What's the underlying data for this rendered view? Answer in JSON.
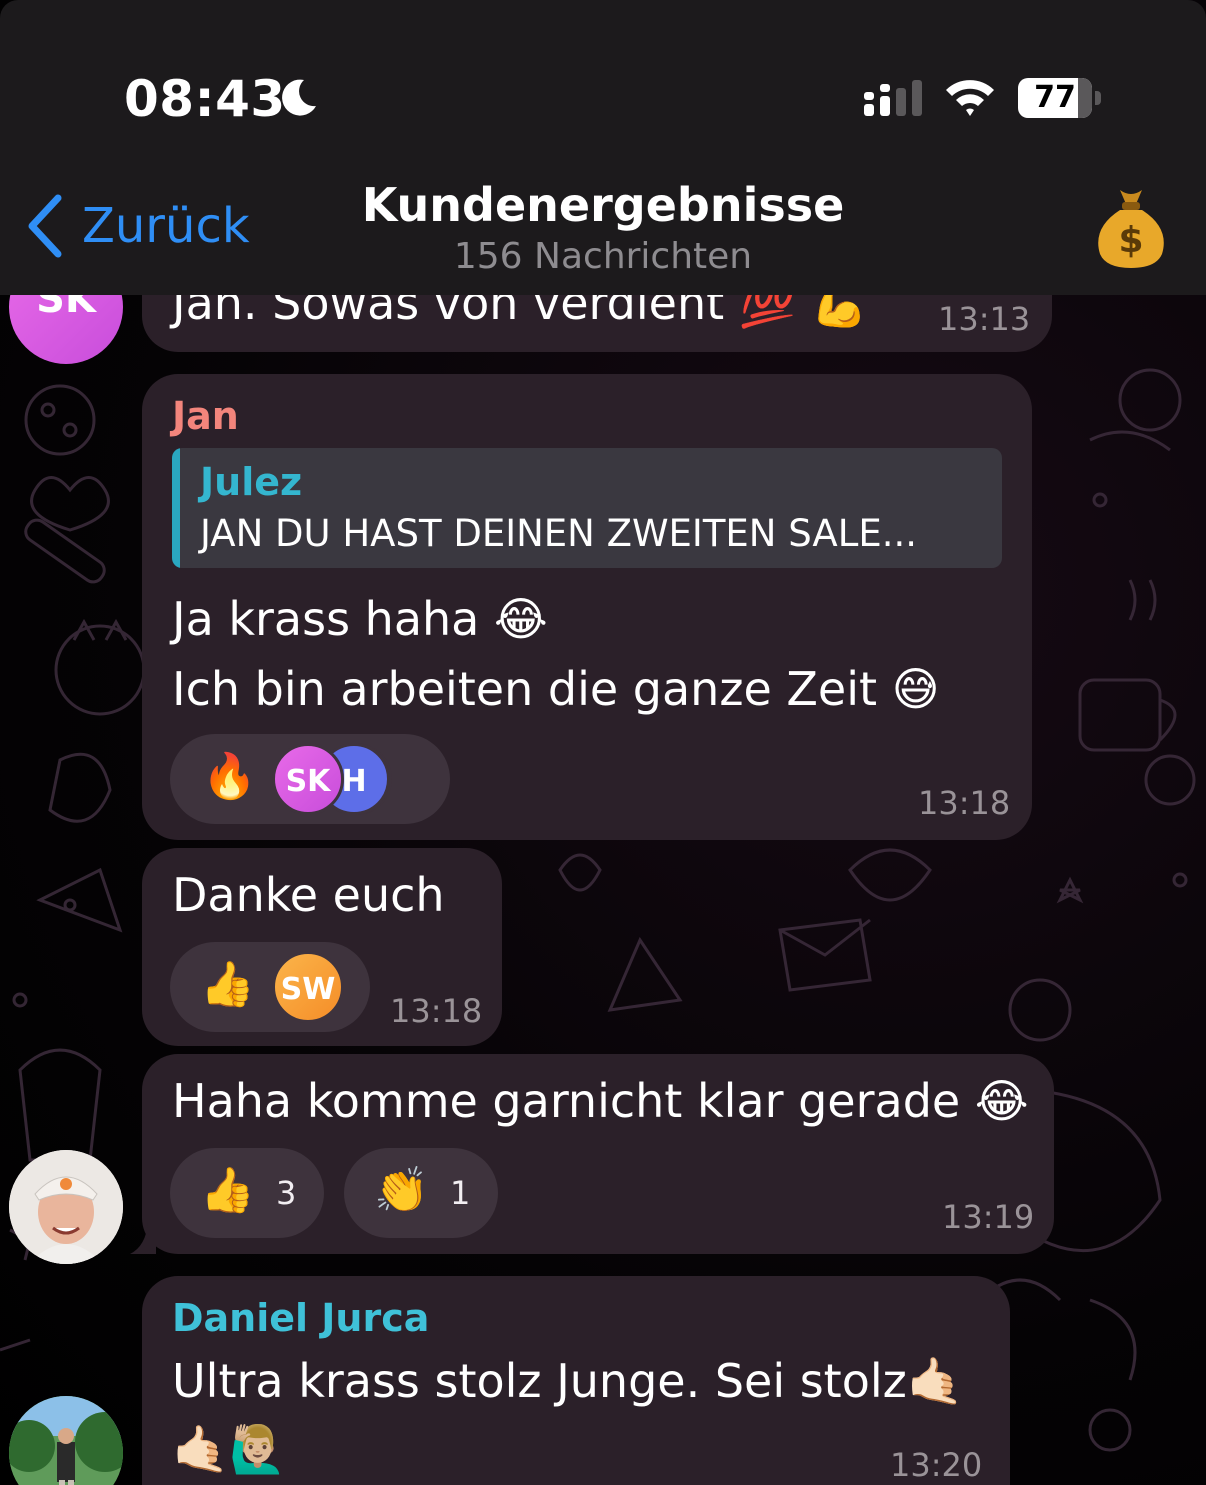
{
  "status_bar": {
    "time": "08:43",
    "battery": "77"
  },
  "header": {
    "back_label": "Zurück",
    "title": "Kundenergebnisse",
    "subtitle": "156 Nachrichten",
    "right_icon": "money-bag-icon"
  },
  "messages": [
    {
      "avatar_initials": "SK",
      "text": "Jan. Sowas von verdient 💯 💪",
      "time": "13:13"
    },
    {
      "sender": "Jan",
      "reply": {
        "name": "Julez",
        "text": "JAN DU HAST DEINEN ZWEITEN SALE..."
      },
      "text_line1": "Ja krass haha 😂",
      "text_line2": "Ich bin arbeiten die ganze Zeit 😅",
      "reaction": {
        "emoji": "🔥",
        "users": [
          "SK",
          "H"
        ]
      },
      "time": "13:18"
    },
    {
      "text": "Danke euch",
      "reaction": {
        "emoji": "👍",
        "users": [
          "SW"
        ]
      },
      "time": "13:18"
    },
    {
      "text": "Haha komme garnicht klar gerade 😂",
      "reactions": [
        {
          "emoji": "👍",
          "count": "3"
        },
        {
          "emoji": "👏",
          "count": "1"
        }
      ],
      "time": "13:19"
    },
    {
      "sender": "Daniel Jurca",
      "text_line1": "Ultra krass stolz Junge. Sei stolz🤙🏻",
      "text_line2": "🤙🏻🙋🏼‍♂️",
      "time": "13:20"
    }
  ],
  "colors": {
    "accent_blue": "#2f8ef5",
    "sender_jan": "#f3857c",
    "sender_daniel": "#3fc1d8",
    "reply_bar": "#2aa7c0",
    "bubble": "#2b2029"
  }
}
